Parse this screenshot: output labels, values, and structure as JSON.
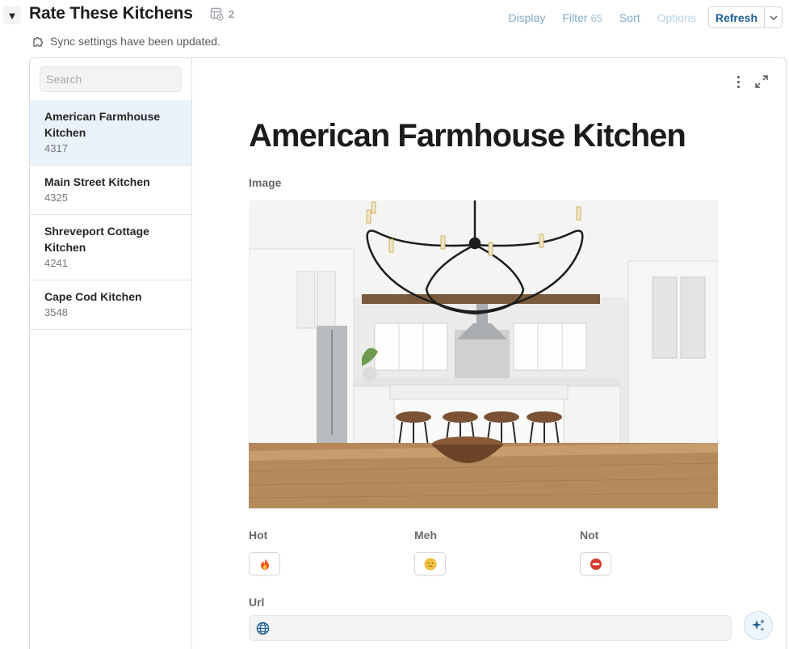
{
  "header": {
    "title": "Rate These Kitchens",
    "synced_count": "2",
    "toolbar": {
      "display": "Display",
      "filter": "Filter",
      "filter_count": "65",
      "sort": "Sort",
      "options": "Options",
      "refresh": "Refresh"
    },
    "sync_note": "Sync settings have been updated."
  },
  "search": {
    "placeholder": "Search"
  },
  "records": [
    {
      "title": "American Farmhouse Kitchen",
      "number": "4317",
      "selected": true
    },
    {
      "title": "Main Street Kitchen",
      "number": "4325",
      "selected": false
    },
    {
      "title": "Shreveport Cottage Kitchen",
      "number": "4241",
      "selected": false
    },
    {
      "title": "Cape Cod Kitchen",
      "number": "3548",
      "selected": false
    }
  ],
  "detail": {
    "title": "American Farmhouse Kitchen",
    "image_label": "Image",
    "ratings": [
      {
        "label": "Hot",
        "icon": "fire-icon"
      },
      {
        "label": "Meh",
        "icon": "meh-face-icon"
      },
      {
        "label": "Not",
        "icon": "no-entry-icon"
      }
    ],
    "url_label": "Url",
    "url_value": ""
  },
  "colors": {
    "accent": "#1c5d96",
    "selected_row": "#e9f2fa",
    "toolbar_link": "#7fa9c9"
  }
}
